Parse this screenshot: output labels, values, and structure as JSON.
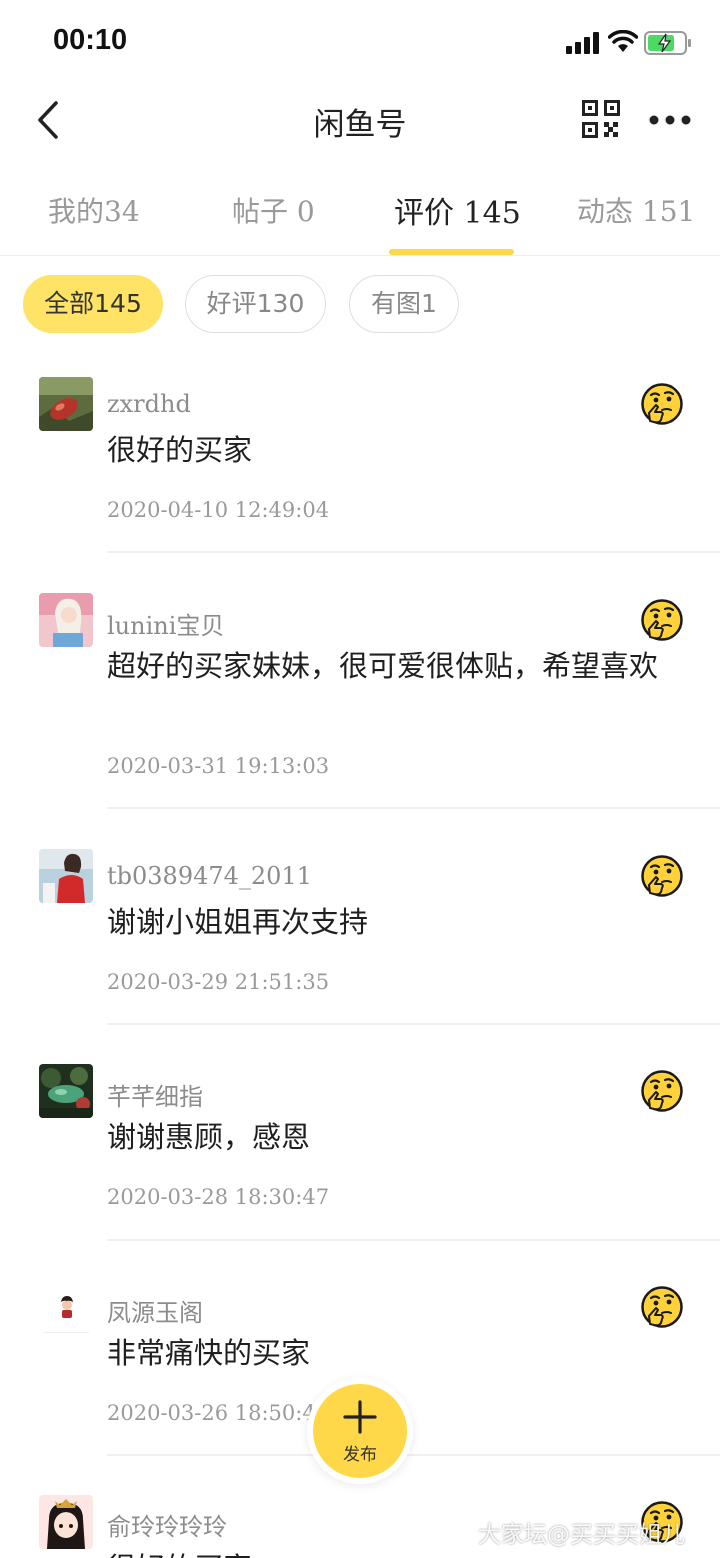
{
  "status_bar": {
    "time": "00:10"
  },
  "nav": {
    "title": "闲鱼号"
  },
  "tabs": [
    {
      "label": "我的34"
    },
    {
      "label": "帖子 0"
    },
    {
      "label": "评价 145"
    },
    {
      "label": "动态 151"
    }
  ],
  "active_tab": 2,
  "filters": [
    {
      "label": "全部145",
      "active": true
    },
    {
      "label": "好评130",
      "active": false
    },
    {
      "label": "有图1",
      "active": false
    }
  ],
  "reviews": [
    {
      "user": "zxrdhd",
      "text": "很好的买家",
      "date": "2020-04-10 12:49:04",
      "rating_icon": "thinking-face-icon"
    },
    {
      "user": "lunini宝贝",
      "text": "超好的买家妹妹，很可爱很体贴，希望喜欢",
      "date": "2020-03-31 19:13:03",
      "rating_icon": "thinking-face-icon"
    },
    {
      "user": "tb0389474_2011",
      "text": "谢谢小姐姐再次支持",
      "date": "2020-03-29 21:51:35",
      "rating_icon": "thinking-face-icon"
    },
    {
      "user": "芊芊细指",
      "text": "谢谢惠顾，感恩",
      "date": "2020-03-28 18:30:47",
      "rating_icon": "thinking-face-icon"
    },
    {
      "user": "凤源玉阁",
      "text": "非常痛快的买家",
      "date": "2020-03-26 18:50:47",
      "rating_icon": "thinking-face-icon"
    },
    {
      "user": "俞玲玲玲玲",
      "text": "很好的买家",
      "date": "",
      "rating_icon": "thinking-face-icon"
    }
  ],
  "fab": {
    "label": "发布"
  },
  "watermark": "大家坛@买买买姐儿",
  "colors": {
    "accent": "#ffd84a",
    "chip_active": "#ffe366",
    "emoji": "#ffd23a"
  }
}
